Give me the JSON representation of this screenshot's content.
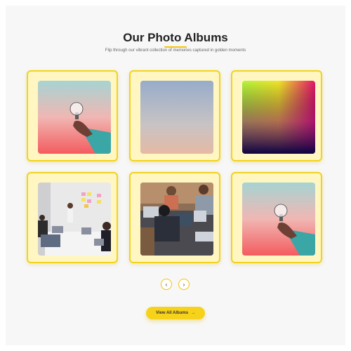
{
  "header": {
    "title": "Our Photo Albums",
    "subtitle": "Flip through our vibrant collection of memories captured in golden moments"
  },
  "albums": [
    {
      "name": "album-lightbulb-hand",
      "icon": "lightbulb-photo"
    },
    {
      "name": "album-sky-gradient",
      "icon": "sky-gradient-photo"
    },
    {
      "name": "album-color-gradient",
      "icon": "color-gradient-photo"
    },
    {
      "name": "album-office-whiteboard",
      "icon": "office-meeting-photo"
    },
    {
      "name": "album-team-laptops",
      "icon": "team-laptops-photo"
    },
    {
      "name": "album-lightbulb-hand-2",
      "icon": "lightbulb-photo"
    }
  ],
  "carousel": {
    "prev_icon": "‹",
    "next_icon": "›"
  },
  "cta": {
    "label": "View All Albums",
    "arrow": "→"
  },
  "colors": {
    "accent": "#f7d21b",
    "card_border": "#f3d21d",
    "card_bg": "#fff6c2"
  }
}
